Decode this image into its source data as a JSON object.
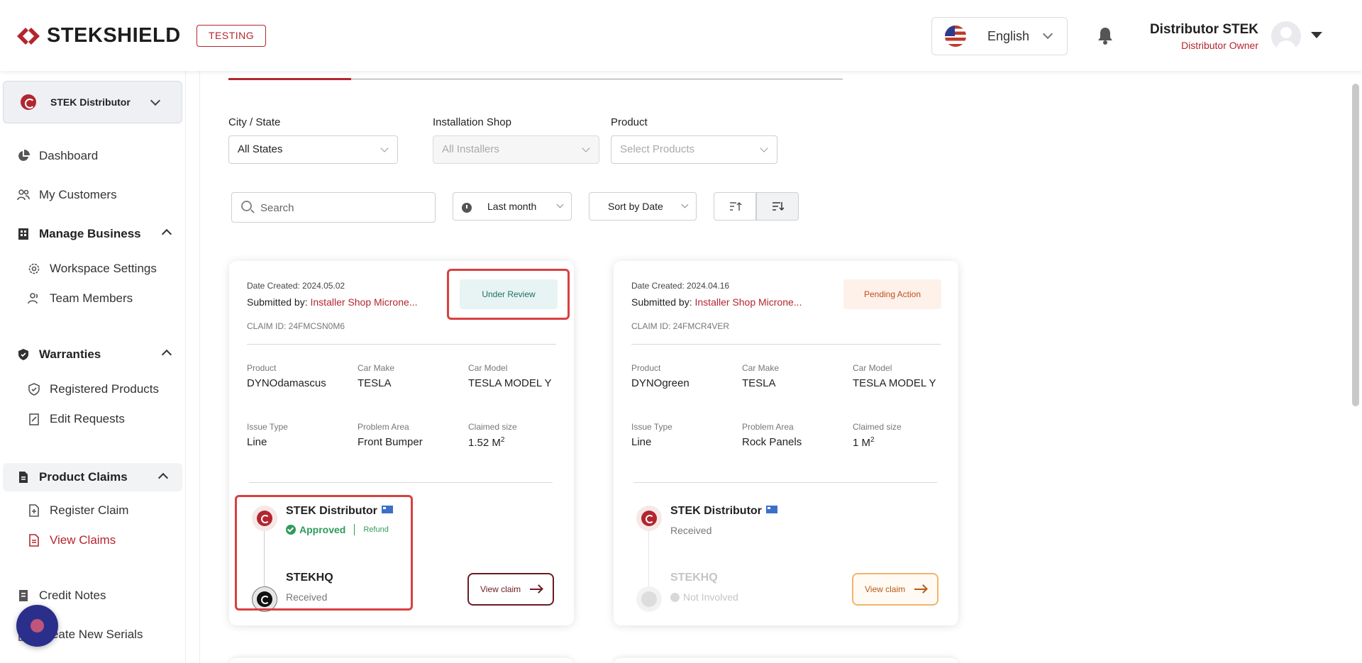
{
  "header": {
    "logo_text": "STEKSHIELD",
    "env_badge": "TESTING",
    "language": "English",
    "user_name": "Distributor STEK",
    "user_role": "Distributor Owner"
  },
  "sidebar": {
    "org": "STEK Distributor",
    "items": [
      {
        "label": "Dashboard",
        "icon": "pie-chart-icon"
      },
      {
        "label": "My Customers",
        "icon": "users-icon"
      },
      {
        "label": "Manage Business",
        "icon": "building-icon"
      },
      {
        "label": "Workspace Settings",
        "icon": "gear-icon"
      },
      {
        "label": "Team Members",
        "icon": "team-icon"
      },
      {
        "label": "Warranties",
        "icon": "shield-check-icon"
      },
      {
        "label": "Registered Products",
        "icon": "shield-icon"
      },
      {
        "label": "Edit Requests",
        "icon": "edit-doc-icon"
      },
      {
        "label": "Product Claims",
        "icon": "document-icon"
      },
      {
        "label": "Register Claim",
        "icon": "add-doc-icon"
      },
      {
        "label": "View Claims",
        "icon": "doc-list-icon"
      },
      {
        "label": "Credit Notes",
        "icon": "receipt-icon"
      },
      {
        "label": "Create New Serials",
        "icon": "serial-icon"
      }
    ]
  },
  "filters": {
    "city_label": "City / State",
    "city_value": "All States",
    "shop_label": "Installation Shop",
    "shop_value": "All Installers",
    "product_label": "Product",
    "product_value": "Select Products",
    "search_placeholder": "Search",
    "period": "Last month",
    "sort": "Sort by Date"
  },
  "cards": [
    {
      "date": "Date Created: 2024.05.02",
      "submitted_prefix": "Submitted by: ",
      "submitted_by": "Installer Shop Microne...",
      "claim_id": "CLAIM ID: 24FMCSN0M6",
      "status": "Under Review",
      "product_label": "Product",
      "product": "DYNOdamascus",
      "make_label": "Car Make",
      "make": "TESLA",
      "model_label": "Car Model",
      "model": "TESLA MODEL Y",
      "issue_label": "Issue Type",
      "issue": "Line",
      "area_label": "Problem Area",
      "area": "Front Bumper",
      "size_label": "Claimed size",
      "size": "1.52 M",
      "size_sup": "2",
      "node1_name": "STEK Distributor",
      "node1_status": "Approved",
      "node1_extra": "Refund",
      "node2_name": "STEKHQ",
      "node2_status": "Received",
      "button": "View claim"
    },
    {
      "date": "Date Created: 2024.04.16",
      "submitted_prefix": "Submitted by: ",
      "submitted_by": "Installer Shop Microne...",
      "claim_id": "CLAIM ID: 24FMCR4VER",
      "status": "Pending Action",
      "product_label": "Product",
      "product": "DYNOgreen",
      "make_label": "Car Make",
      "make": "TESLA",
      "model_label": "Car Model",
      "model": "TESLA MODEL Y",
      "issue_label": "Issue Type",
      "issue": "Line",
      "area_label": "Problem Area",
      "area": "Rock Panels",
      "size_label": "Claimed size",
      "size": "1 M",
      "size_sup": "2",
      "node1_name": "STEK Distributor",
      "node1_status": "Received",
      "node2_name": "STEKHQ",
      "node2_status": "Not Involved",
      "button": "View claim"
    }
  ]
}
